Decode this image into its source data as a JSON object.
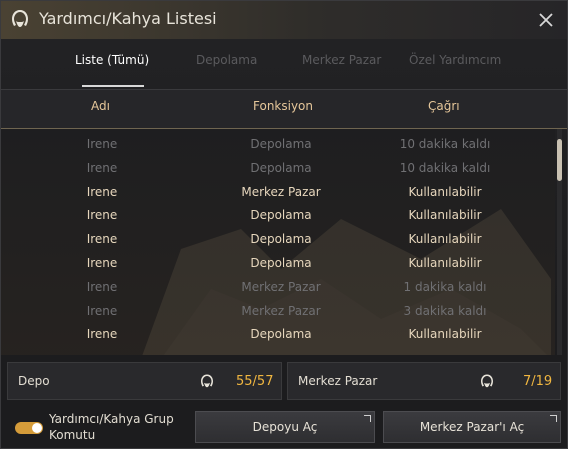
{
  "window": {
    "title": "Yardımcı/Kahya Listesi"
  },
  "tabs": [
    {
      "label": "Liste (Tümü)",
      "active": true
    },
    {
      "label": "Depolama",
      "active": false
    },
    {
      "label": "Merkez Pazar",
      "active": false
    },
    {
      "label": "Özel Yardımcım",
      "active": false
    }
  ],
  "columns": {
    "name": "Adı",
    "function": "Fonksiyon",
    "call": "Çağrı"
  },
  "rows": [
    {
      "name": "Irene",
      "function": "Depolama",
      "call": "10 dakika kaldı",
      "available": false
    },
    {
      "name": "Irene",
      "function": "Depolama",
      "call": "10 dakika kaldı",
      "available": false
    },
    {
      "name": "Irene",
      "function": "Merkez Pazar",
      "call": "Kullanılabilir",
      "available": true
    },
    {
      "name": "Irene",
      "function": "Depolama",
      "call": "Kullanılabilir",
      "available": true
    },
    {
      "name": "Irene",
      "function": "Depolama",
      "call": "Kullanılabilir",
      "available": true
    },
    {
      "name": "Irene",
      "function": "Depolama",
      "call": "Kullanılabilir",
      "available": true
    },
    {
      "name": "Irene",
      "function": "Merkez Pazar",
      "call": "1 dakika kaldı",
      "available": false
    },
    {
      "name": "Irene",
      "function": "Merkez Pazar",
      "call": "3 dakika kaldı",
      "available": false
    },
    {
      "name": "Irene",
      "function": "Depolama",
      "call": "Kullanılabilir",
      "available": true
    }
  ],
  "summary": {
    "storage": {
      "label": "Depo",
      "count": "55/57"
    },
    "market": {
      "label": "Merkez Pazar",
      "count": "7/19"
    }
  },
  "group_command": {
    "label": "Yardımcı/Kahya Grup Komutu",
    "enabled": true
  },
  "buttons": {
    "open_storage": "Depoyu Aç",
    "open_market": "Merkez Pazar'ı Aç"
  },
  "colors": {
    "accent_gold": "#f0b640",
    "header_gold": "#e6c79a",
    "toggle_on": "#d59c3a"
  },
  "icons": {
    "title": "helper-head-icon",
    "close": "close-icon",
    "count": "helper-head-icon"
  }
}
